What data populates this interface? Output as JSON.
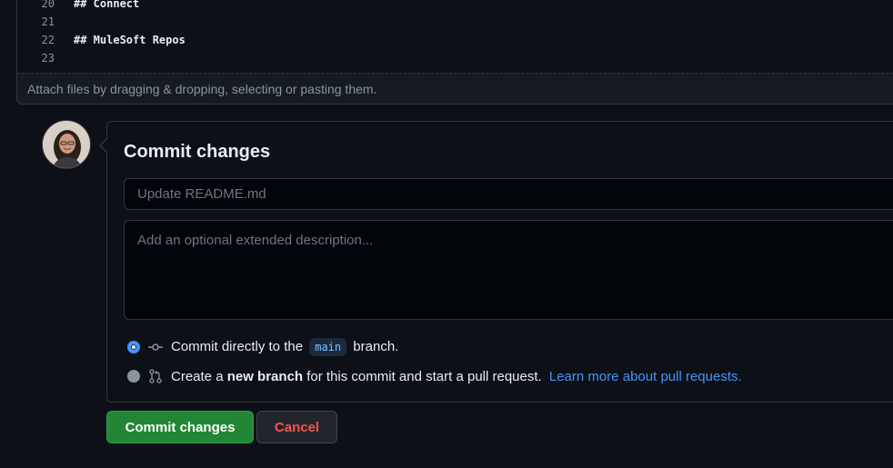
{
  "editor": {
    "lines": [
      {
        "number": "20",
        "content": "## Connect"
      },
      {
        "number": "21",
        "content": ""
      },
      {
        "number": "22",
        "content": "## MuleSoft Repos"
      },
      {
        "number": "23",
        "content": ""
      }
    ],
    "attach_hint": "Attach files by dragging & dropping, selecting or pasting them."
  },
  "commit": {
    "title": "Commit changes",
    "summary_placeholder": "Update README.md",
    "description_placeholder": "Add an optional extended description...",
    "option_direct": {
      "prefix": "Commit directly to the",
      "branch": "main",
      "suffix": "branch.",
      "selected": true
    },
    "option_new_branch": {
      "prefix": "Create a",
      "bold": "new branch",
      "suffix": "for this commit and start a pull request.",
      "link": "Learn more about pull requests.",
      "selected": false
    },
    "submit_label": "Commit changes",
    "cancel_label": "Cancel"
  },
  "icons": {
    "commit": "git-commit-icon",
    "pull_request": "git-pull-request-icon",
    "avatar": "user-avatar"
  },
  "colors": {
    "background": "#0d1117",
    "primary_button": "#238636",
    "danger_text": "#f85149",
    "link": "#4493f8"
  }
}
